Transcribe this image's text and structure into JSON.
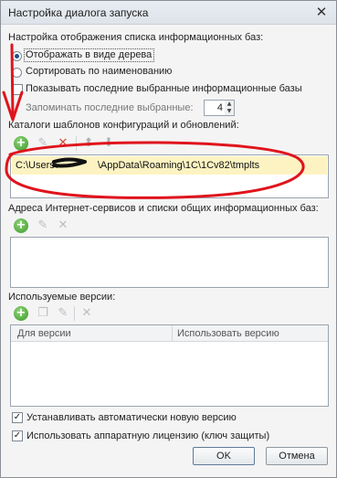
{
  "window": {
    "title": "Настройка диалога запуска",
    "close_glyph": "✕"
  },
  "display_settings": {
    "heading": "Настройка отображения списка информационных баз:",
    "tree_view_label": "Отображать в виде дерева",
    "tree_view_selected": true,
    "sort_by_name_label": "Сортировать по наименованию",
    "sort_by_name_selected": false,
    "show_recent_label": "Показывать последние выбранные информационные базы",
    "show_recent_checked": false,
    "remember_recent_label": "Запоминать последние выбранные:",
    "remember_recent_value": "4"
  },
  "templates": {
    "heading": "Каталоги шаблонов конфигураций и обновлений:",
    "toolbar": [
      "add-icon",
      "edit-icon",
      "delete-icon",
      "move-up-icon",
      "move-down-icon"
    ],
    "path_prefix": "C:\\Users\\",
    "path_suffix": "\\AppData\\Roaming\\1C\\1Cv82\\tmplts"
  },
  "internet_services": {
    "heading": "Адреса Интернет-сервисов и списки общих информационных баз:",
    "toolbar": [
      "add-icon",
      "edit-icon",
      "delete-icon"
    ]
  },
  "versions": {
    "heading": "Используемые версии:",
    "toolbar": [
      "add-icon",
      "copy-icon",
      "edit-icon",
      "delete-icon"
    ],
    "columns": [
      "Для версии",
      "Использовать версию"
    ]
  },
  "options": {
    "auto_install_label": "Устанавливать автоматически новую версию",
    "auto_install_checked": true,
    "hardware_license_label": "Использовать аппаратную лицензию (ключ защиты)",
    "hardware_license_checked": true,
    "check_glyph": "✓"
  },
  "buttons": {
    "ok": "OK",
    "cancel": "Отмена"
  },
  "annotation": {
    "color": "#e0141c"
  },
  "colors": {
    "selection_row": "#fdf3c2",
    "add_icon": "#3a9a26"
  }
}
